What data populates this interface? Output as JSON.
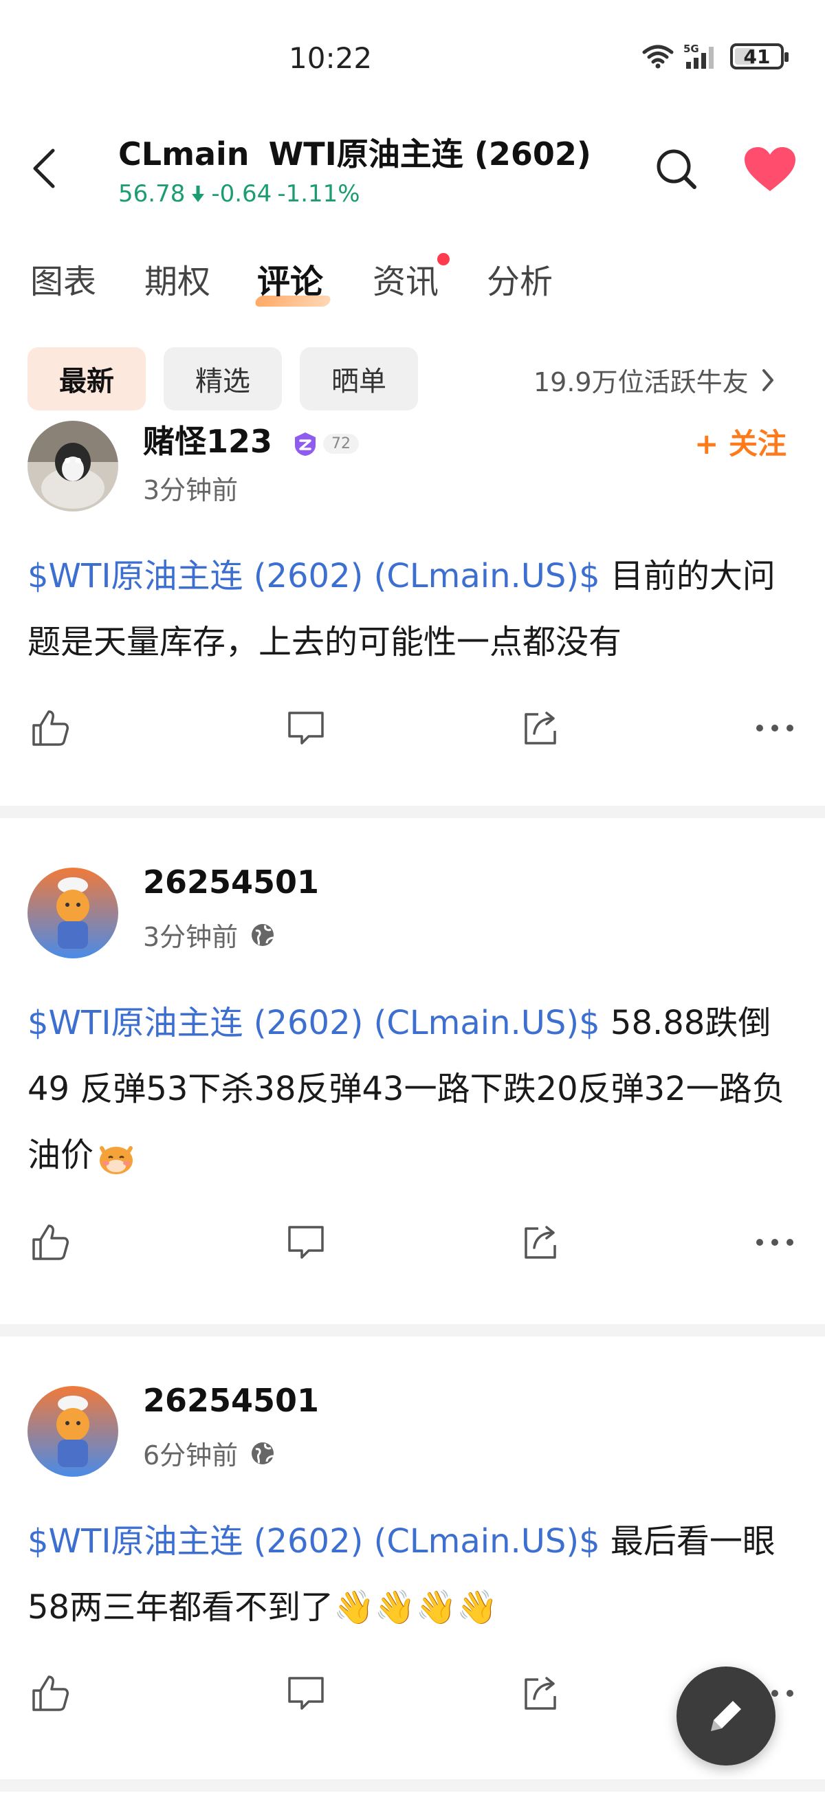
{
  "status_bar": {
    "time": "10:22",
    "network": "5G",
    "battery": "41"
  },
  "header": {
    "symbol": "CLmain",
    "name": "WTI原油主连 (2602)",
    "price": "56.78",
    "change": "-0.64",
    "change_pct": "-1.11%",
    "trend": "down",
    "colors": {
      "down": "#1a9d6f",
      "heart": "#ff4d6d"
    }
  },
  "tabs": [
    {
      "label": "图表",
      "active": false
    },
    {
      "label": "期权",
      "active": false
    },
    {
      "label": "评论",
      "active": true
    },
    {
      "label": "资讯",
      "active": false,
      "has_dot": true
    },
    {
      "label": "分析",
      "active": false
    }
  ],
  "filters": {
    "chips": [
      {
        "label": "最新",
        "active": true
      },
      {
        "label": "精选",
        "active": false
      },
      {
        "label": "晒单",
        "active": false
      }
    ],
    "active_users": "19.9万位活跃牛友"
  },
  "posts": [
    {
      "username": "赌怪123",
      "level": "72",
      "time": "3分钟前",
      "follow_label": "+ 关注",
      "tag": "$WTI原油主连 (2602) (CLmain.US)$",
      "text": " 目前的大问题是天量库存，上去的可能性一点都没有"
    },
    {
      "username": "26254501",
      "time": "3分钟前",
      "tag": "$WTI原油主连 (2602) (CLmain.US)$",
      "text": " 58.88跌倒49 反弹53下杀38反弹43一路下跌20反弹32一路负油价"
    },
    {
      "username": "26254501",
      "time": "6分钟前",
      "tag": "$WTI原油主连 (2602) (CLmain.US)$",
      "text": " 最后看一眼58两三年都看不到了👋👋👋👋"
    }
  ],
  "icons": {
    "back": "chevron-left-icon",
    "search": "search-icon",
    "favorite": "heart-icon",
    "like": "thumbs-up-icon",
    "comment": "comment-icon",
    "share": "share-icon",
    "more": "more-icon",
    "globe": "globe-icon",
    "compose": "pencil-icon"
  },
  "accent": {
    "tag": "#3d6fd0",
    "follow": "#ff7a1a"
  }
}
